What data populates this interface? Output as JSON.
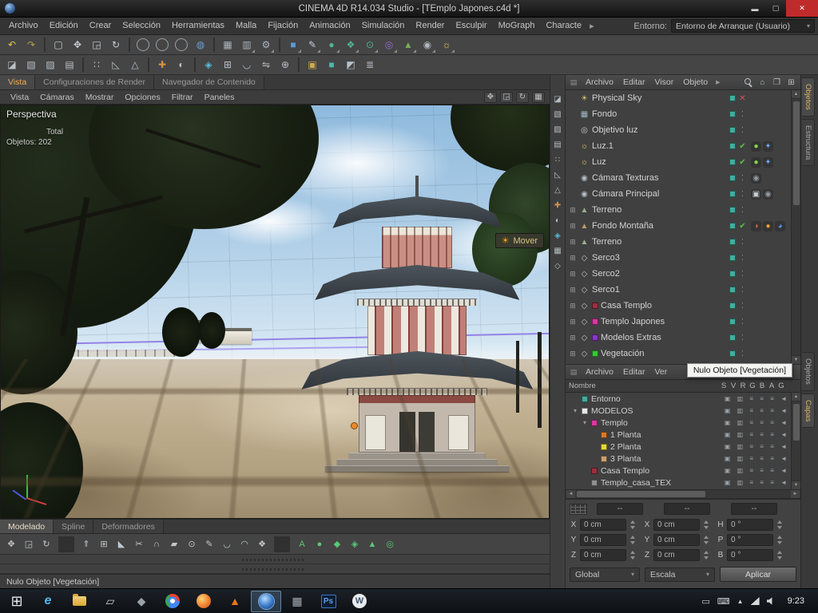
{
  "window": {
    "title": "CINEMA 4D R14.034 Studio - [TEmplo Japones.c4d *]",
    "minimize": "▬",
    "maximize": "▢",
    "close": "✕"
  },
  "menu_bar": {
    "items": [
      "Archivo",
      "Edición",
      "Crear",
      "Selección",
      "Herramientas",
      "Malla",
      "Fijación",
      "Animación",
      "Simulación",
      "Render",
      "Esculpir",
      "MoGraph",
      "Characte"
    ],
    "overflow": "▸",
    "entorno_label": "Entorno:",
    "entorno_value": "Entorno de Arranque (Usuario)"
  },
  "toolbar_row1": [
    {
      "n": "undo-icon",
      "g": "↶",
      "c": "#e0c84a"
    },
    {
      "n": "redo-icon",
      "g": "↷",
      "c": "#b0a245"
    },
    {
      "n": "toolbar-separator",
      "cls": "sep",
      "ia": "false"
    },
    {
      "n": "live-selection-icon",
      "g": "▢",
      "c": "#c8cdd2"
    },
    {
      "n": "move-icon",
      "g": "✥",
      "c": "#c8cdd2"
    },
    {
      "n": "scale-icon",
      "g": "◲",
      "c": "#c8cdd2"
    },
    {
      "n": "rotate-icon",
      "g": "↻",
      "c": "#c8cdd2"
    },
    {
      "n": "toolbar-separator",
      "cls": "sep",
      "ia": "false"
    },
    {
      "n": "lock-x-axis-icon",
      "g": "X",
      "cls": "circ"
    },
    {
      "n": "lock-y-axis-icon",
      "g": "Y",
      "cls": "circ"
    },
    {
      "n": "lock-z-axis-icon",
      "g": "Z",
      "cls": "circ"
    },
    {
      "n": "coordinate-system-icon",
      "g": "◍",
      "c": "#6a9fd8"
    },
    {
      "n": "toolbar-separator",
      "cls": "sep",
      "ia": "false"
    },
    {
      "n": "render-view-icon",
      "g": "▦",
      "c": "#aab4bd"
    },
    {
      "n": "render-picture-viewer-icon",
      "g": "▥",
      "c": "#aab4bd",
      "arrow": true
    },
    {
      "n": "render-settings-icon",
      "g": "⚙",
      "c": "#aab4bd",
      "arrow": true
    },
    {
      "n": "toolbar-separator",
      "cls": "sep",
      "ia": "false"
    },
    {
      "n": "add-cube-icon",
      "g": "■",
      "c": "#5b9bd5",
      "arrow": true
    },
    {
      "n": "add-spline-icon",
      "g": "✎",
      "c": "#c8cdd2",
      "arrow": true
    },
    {
      "n": "add-subdivision-icon",
      "g": "●",
      "c": "#4db893",
      "arrow": true
    },
    {
      "n": "add-array-icon",
      "g": "❖",
      "c": "#4db893",
      "arrow": true
    },
    {
      "n": "add-boole-icon",
      "g": "⊙",
      "c": "#4db893",
      "arrow": true
    },
    {
      "n": "add-deformer-icon",
      "g": "◎",
      "c": "#9a6ad8",
      "arrow": true
    },
    {
      "n": "add-floor-icon",
      "g": "▲",
      "c": "#7aa85a",
      "arrow": true
    },
    {
      "n": "add-camera-icon",
      "g": "◉",
      "c": "#b0b8c0",
      "arrow": true
    },
    {
      "n": "add-light-icon",
      "g": "☼",
      "c": "#e8d060",
      "arrow": true
    }
  ],
  "toolbar_row2": [
    {
      "n": "make-editable-icon",
      "g": "◪",
      "c": "#b8c0c8"
    },
    {
      "n": "model-mode-icon",
      "g": "▧",
      "c": "#b8c0c8"
    },
    {
      "n": "texture-mode-icon",
      "g": "▨",
      "c": "#b8c0c8"
    },
    {
      "n": "workplane-mode-icon",
      "g": "▤",
      "c": "#b8c0c8"
    },
    {
      "n": "toolbar-separator",
      "cls": "sep",
      "ia": "false"
    },
    {
      "n": "points-mode-icon",
      "g": "∷",
      "c": "#b8c0c8"
    },
    {
      "n": "edges-mode-icon",
      "g": "◺",
      "c": "#b8c0c8"
    },
    {
      "n": "polygons-mode-icon",
      "g": "△",
      "c": "#b8c0c8"
    },
    {
      "n": "toolbar-separator",
      "cls": "sep",
      "ia": "false"
    },
    {
      "n": "enable-axis-icon",
      "g": "✚",
      "c": "#d89040"
    },
    {
      "n": "viewport-solo-icon",
      "g": "◐",
      "c": "#b8c0c8"
    },
    {
      "n": "toolbar-separator",
      "cls": "sep",
      "ia": "false"
    },
    {
      "n": "enable-snap-icon",
      "g": "◈",
      "c": "#58b8d8"
    },
    {
      "n": "quantize-icon",
      "g": "⊞",
      "c": "#b8c0c8"
    },
    {
      "n": "magnet-icon",
      "g": "◡",
      "c": "#b8c0c8"
    },
    {
      "n": "mirror-icon",
      "g": "⇋",
      "c": "#b8c0c8"
    },
    {
      "n": "axis-center-icon",
      "g": "⊕",
      "c": "#b8c0c8"
    },
    {
      "n": "toolbar-separator",
      "cls": "sep",
      "ia": "false"
    },
    {
      "n": "content-browser-icon",
      "g": "▣",
      "c": "#d0a850"
    },
    {
      "n": "objects-palette-icon",
      "g": "■",
      "c": "#4db8a8"
    },
    {
      "n": "materials-palette-icon",
      "g": "◩",
      "c": "#b8c0c8"
    },
    {
      "n": "layers-palette-icon",
      "g": "≣",
      "c": "#b8c0c8"
    }
  ],
  "doc_tabs": [
    {
      "label": "Vista",
      "active": true
    },
    {
      "label": "Configuraciones de Render"
    },
    {
      "label": "Navegador de Contenido"
    }
  ],
  "viewport": {
    "menus": [
      "Vista",
      "Cámaras",
      "Mostrar",
      "Opciones",
      "Filtrar",
      "Paneles"
    ],
    "controls": [
      {
        "n": "pan-view-icon",
        "g": "✥"
      },
      {
        "n": "zoom-view-icon",
        "g": "◲"
      },
      {
        "n": "rotate-view-icon",
        "g": "↻"
      },
      {
        "n": "toggle-panels-icon",
        "g": "▦"
      }
    ],
    "hud": [
      {
        "t": "Perspectiva",
        "cls": "h1"
      },
      {
        "t": "Total",
        "cls": "h2"
      },
      {
        "t": "Objetos: 202",
        "cls": "h3"
      }
    ],
    "tool_hint": {
      "label": "Mover",
      "icon": "☀"
    }
  },
  "mode_strip": [
    {
      "n": "make-editable-icon",
      "g": "◪"
    },
    {
      "n": "model-mode-icon",
      "g": "▧"
    },
    {
      "n": "texture-mode-icon",
      "g": "▨"
    },
    {
      "n": "workplane-mode-icon",
      "g": "▤"
    },
    {
      "n": "points-mode-icon",
      "g": "∷"
    },
    {
      "n": "edges-mode-icon",
      "g": "◺"
    },
    {
      "n": "polygons-mode-icon",
      "g": "△"
    },
    {
      "n": "enable-axis-icon",
      "g": "✚",
      "c": "#d89040"
    },
    {
      "n": "viewport-solo-icon",
      "g": "◐"
    },
    {
      "n": "snap-icon",
      "g": "◈",
      "c": "#58b8d8"
    },
    {
      "n": "workplane-snap-icon",
      "g": "▦"
    },
    {
      "n": "lock-icon",
      "g": "◇"
    }
  ],
  "object_manager": {
    "menus": [
      "Archivo",
      "Editar",
      "Visor",
      "Objeto"
    ],
    "overflow": "▸",
    "header_icons": [
      {
        "n": "search-icon",
        "g": "",
        "cls": "search"
      },
      {
        "n": "home-icon",
        "g": "⌂"
      },
      {
        "n": "compare-view-icon",
        "g": "❐"
      },
      {
        "n": "add-view-icon",
        "g": "⊞"
      }
    ],
    "objects": [
      {
        "name": "Physical Sky",
        "exp": "",
        "icon_name": "sky-object-icon",
        "icon_glyph": "☀",
        "icon_color": "#d8c070",
        "chip": "#3fae9f",
        "vis_glyph": "✕",
        "vis_color": "#e05050"
      },
      {
        "name": "Fondo",
        "exp": "",
        "icon_name": "background-object-icon",
        "icon_glyph": "▦",
        "icon_color": "#9fb6c4",
        "chip": "#3fae9f",
        "vis_glyph": "⁚",
        "vis_color": "#d08050"
      },
      {
        "name": "Objetivo luz",
        "exp": "",
        "icon_name": "null-object-icon",
        "icon_glyph": "◎",
        "icon_color": "#c4c8cc",
        "chip": "#3fae9f",
        "vis_glyph": "⁚",
        "vis_color": "#d08050"
      },
      {
        "name": "Luz.1",
        "exp": "",
        "icon_name": "light-object-icon",
        "icon_glyph": "☼",
        "icon_color": "#e6d470",
        "chip": "#3fae9f",
        "vis_glyph": "✔",
        "vis_color": "#55c83a",
        "tag1": {
          "g": "●",
          "c": "#86d84a"
        },
        "tag2": {
          "g": "✦",
          "c": "#6aa0e8"
        }
      },
      {
        "name": "Luz",
        "exp": "",
        "icon_name": "light-object-icon",
        "icon_glyph": "☼",
        "icon_color": "#e6d470",
        "chip": "#3fae9f",
        "vis_glyph": "✔",
        "vis_color": "#55c83a",
        "tag1": {
          "g": "●",
          "c": "#86d84a"
        },
        "tag2": {
          "g": "✦",
          "c": "#6aa0e8"
        }
      },
      {
        "name": "Cámara Texturas",
        "exp": "",
        "icon_name": "camera-object-icon",
        "icon_glyph": "◉",
        "icon_color": "#b6bcc2",
        "chip": "#3fae9f",
        "vis_glyph": "⁚",
        "vis_color": "#d08050",
        "tag1": {
          "g": "◉",
          "c": "#9098a0"
        }
      },
      {
        "name": "Cámara Principal",
        "exp": "",
        "icon_name": "camera-object-icon",
        "icon_glyph": "◉",
        "icon_color": "#b6bcc2",
        "chip": "#3fae9f",
        "vis_glyph": "⁚",
        "vis_color": "#d08050",
        "tag1": {
          "g": "▣",
          "c": "#c8ccd0"
        },
        "tag2": {
          "g": "◉",
          "c": "#9098a0"
        }
      },
      {
        "name": "Terreno",
        "exp": "⊞",
        "icon_name": "terrain-object-icon",
        "icon_glyph": "▲",
        "icon_color": "#9fae8e",
        "chip": "#3fae9f",
        "vis_glyph": "⁚",
        "vis_color": "#d08050"
      },
      {
        "name": "Fondo Montaña",
        "exp": "⊞",
        "icon_name": "background-mountain-icon",
        "icon_glyph": "▲",
        "icon_color": "#b89a6a",
        "chip": "#3fae9f",
        "vis_glyph": "✔",
        "vis_color": "#55c83a",
        "tag1": {
          "g": "◑",
          "c": "#e06050"
        },
        "tag2": {
          "g": "●",
          "c": "#e8a030"
        },
        "tag3": {
          "g": "◕",
          "c": "#5890d8"
        }
      },
      {
        "name": "Terreno",
        "exp": "⊞",
        "icon_name": "terrain-object-icon",
        "icon_glyph": "▲",
        "icon_color": "#9fae8e",
        "chip": "#3fae9f",
        "vis_glyph": "⁚",
        "vis_color": "#d08050"
      },
      {
        "name": "Serco3",
        "exp": "⊞",
        "icon_name": "null-object-icon",
        "icon_glyph": "◇",
        "icon_color": "#c0c4c8",
        "chip": "#3fae9f",
        "vis_glyph": "⁚",
        "vis_color": "#d08050"
      },
      {
        "name": "Serco2",
        "exp": "⊞",
        "icon_name": "null-object-icon",
        "icon_glyph": "◇",
        "icon_color": "#c0c4c8",
        "chip": "#3fae9f",
        "vis_glyph": "⁚",
        "vis_color": "#d08050"
      },
      {
        "name": "Serco1",
        "exp": "⊞",
        "icon_name": "null-object-icon",
        "icon_glyph": "◇",
        "icon_color": "#c0c4c8",
        "chip": "#3fae9f",
        "vis_glyph": "⁚",
        "vis_color": "#d08050"
      },
      {
        "name": "Casa Templo",
        "exp": "⊞",
        "icon_name": "null-object-icon",
        "icon_glyph": "◇",
        "icon_color": "#c0c4c8",
        "left_chip": "#9a2f40",
        "chip": "#3fae9f",
        "vis_glyph": "⁚",
        "vis_color": "#d08050"
      },
      {
        "name": "Templo Japones",
        "exp": "⊞",
        "icon_name": "null-object-icon",
        "icon_glyph": "◇",
        "icon_color": "#c0c4c8",
        "left_chip": "#d838a0",
        "chip": "#3fae9f",
        "vis_glyph": "⁚",
        "vis_color": "#d08050"
      },
      {
        "name": "Modelos Extras",
        "exp": "⊞",
        "icon_name": "null-object-icon",
        "icon_glyph": "◇",
        "icon_color": "#c0c4c8",
        "left_chip": "#8838c8",
        "chip": "#3fae9f",
        "vis_glyph": "⁚",
        "vis_color": "#d08050"
      },
      {
        "name": "Vegetación",
        "exp": "⊞",
        "icon_name": "null-object-icon",
        "icon_glyph": "◇",
        "icon_color": "#c0c4c8",
        "left_chip": "#38c838",
        "chip": "#3fae9f",
        "vis_glyph": "⁚",
        "vis_color": "#d08050"
      }
    ]
  },
  "layer_manager": {
    "menus": [
      "Archivo",
      "Editar",
      "Ver"
    ],
    "name_col": "Nombre",
    "columns": [
      "S",
      "V",
      "R",
      "G",
      "B",
      "A",
      "G"
    ],
    "row_cells": "▣ ▥ ≡ ≡ ≡ ◄",
    "layers": [
      {
        "name": "Entorno",
        "color": "#3fae9f",
        "pad": "8px",
        "exp": ""
      },
      {
        "name": "MODELOS",
        "color": "#e8e8e8",
        "pad": "8px",
        "exp": "▾"
      },
      {
        "name": "Templo",
        "color": "#d838a0",
        "pad": "20px",
        "exp": "▾"
      },
      {
        "name": "1 Planta",
        "color": "#d87828",
        "pad": "32px",
        "exp": ""
      },
      {
        "name": "2 Planta",
        "color": "#e8d838",
        "pad": "32px",
        "exp": ""
      },
      {
        "name": "3 Planta",
        "color": "#c8a070",
        "pad": "32px",
        "exp": ""
      },
      {
        "name": "Casa Templo",
        "color": "#9a2f40",
        "pad": "20px",
        "exp": ""
      },
      {
        "name": "Templo_casa_TEX",
        "color": "#909090",
        "pad": "20px",
        "exp": ""
      }
    ]
  },
  "side_tabs": {
    "top": [
      {
        "label": "Objetos",
        "active": true
      },
      {
        "label": "Estructura"
      }
    ],
    "bottom": [
      {
        "label": "Objetos"
      },
      {
        "label": "Capas",
        "active": true
      }
    ]
  },
  "bottom_tabs": [
    {
      "label": "Modelado",
      "active": true
    },
    {
      "label": "Spline"
    },
    {
      "label": "Deformadores"
    }
  ],
  "tool_row": [
    {
      "n": "move-tool-icon",
      "g": "✥"
    },
    {
      "n": "scale-tool-icon",
      "g": "◲"
    },
    {
      "n": "rotate-tool-icon",
      "g": "↻"
    },
    {
      "n": "toolbar-separator",
      "cls": "sep",
      "ia": "false"
    },
    {
      "n": "extrude-icon",
      "g": "⇑"
    },
    {
      "n": "extrude-inner-icon",
      "g": "⊞"
    },
    {
      "n": "bevel-icon",
      "g": "◣"
    },
    {
      "n": "knife-icon",
      "g": "✂"
    },
    {
      "n": "bridge-icon",
      "g": "∩"
    },
    {
      "n": "close-polygon-icon",
      "g": "▰"
    },
    {
      "n": "weld-icon",
      "g": "⊙"
    },
    {
      "n": "brush-icon",
      "g": "✎"
    },
    {
      "n": "magnet-tool-icon",
      "g": "◡"
    },
    {
      "n": "smooth-shift-icon",
      "g": "◠"
    },
    {
      "n": "array-tool-icon",
      "g": "❖"
    },
    {
      "n": "toolbar-separator",
      "cls": "sep",
      "ia": "false"
    },
    {
      "n": "auto-snap-icon",
      "g": "A",
      "c": "#58c878"
    },
    {
      "n": "snap-3d-icon",
      "g": "●",
      "c": "#58c878"
    },
    {
      "n": "point-snap-icon",
      "g": "◆",
      "c": "#58c878"
    },
    {
      "n": "edge-snap-icon",
      "g": "◈",
      "c": "#58c878"
    },
    {
      "n": "polygon-snap-icon",
      "g": "▲",
      "c": "#58c878"
    },
    {
      "n": "guide-snap-icon",
      "g": "◎",
      "c": "#58c878"
    }
  ],
  "status": {
    "text": "Nulo  Objeto [Vegetación]"
  },
  "tooltip": {
    "text": "Nulo  Objeto [Vegetación]"
  },
  "coordinates": {
    "header": [
      "--",
      "--",
      "--"
    ],
    "rows": [
      {
        "l1": "X",
        "v1": "0 cm",
        "l2": "X",
        "v2": "0 cm",
        "l3": "H",
        "v3": "0 °"
      },
      {
        "l1": "Y",
        "v1": "0 cm",
        "l2": "Y",
        "v2": "0 cm",
        "l3": "P",
        "v3": "0 °"
      },
      {
        "l1": "Z",
        "v1": "0 cm",
        "l2": "Z",
        "v2": "0 cm",
        "l3": "B",
        "v3": "0 °"
      }
    ],
    "dropdown1": "Global",
    "dropdown2": "Escala",
    "apply": "Aplicar"
  },
  "taskbar": {
    "icons": [
      {
        "n": "start-button",
        "g": "⊞",
        "cls": "start"
      },
      {
        "n": "ie-icon",
        "g": "e",
        "cls": "ie"
      },
      {
        "n": "folder-icon",
        "g": "",
        "cls": "folder"
      },
      {
        "n": "media-app-icon",
        "g": "▱",
        "c": "#cfd4da"
      },
      {
        "n": "utility-app-icon",
        "g": "◆",
        "c": "#9aa2a8"
      },
      {
        "n": "chrome-icon",
        "g": "",
        "cls": "chrome"
      },
      {
        "n": "firefox-icon",
        "g": "",
        "cls": "firefox"
      },
      {
        "n": "vlc-icon",
        "g": "▲",
        "c": "#e87818"
      },
      {
        "n": "cinema4d-app-icon",
        "g": "",
        "cls": "orb",
        "active": true
      },
      {
        "n": "app-icon",
        "g": "▦",
        "c": "#a8b0b8"
      },
      {
        "n": "photoshop-icon",
        "g": "Ps",
        "cls": "ps"
      },
      {
        "n": "wordpress-icon",
        "g": "W",
        "cls": "wp"
      }
    ],
    "tray": {
      "ime": "▭",
      "keyboard": "⌨",
      "chevron": "▲"
    },
    "clock": "9:23"
  },
  "colors": {
    "accent": "#e8b05a",
    "chip_teal": "#3fae9f",
    "check_green": "#55c83a",
    "cross_red": "#e05050"
  }
}
